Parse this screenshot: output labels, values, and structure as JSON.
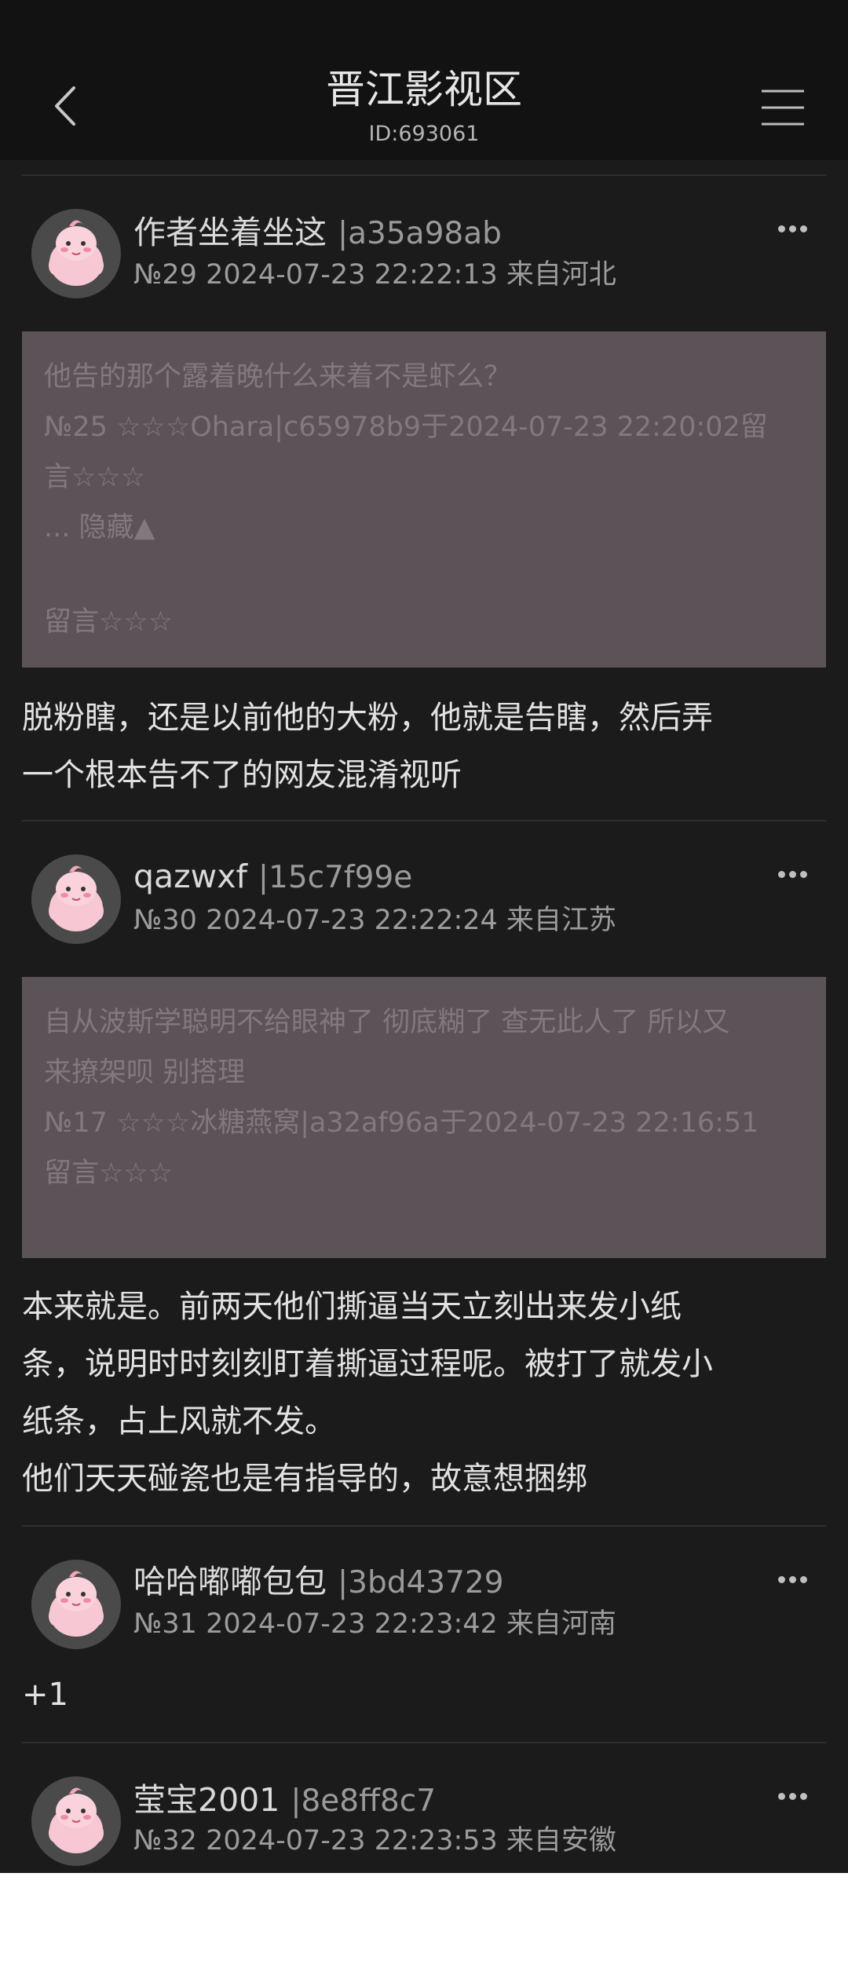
{
  "header": {
    "title": "晋江影视区",
    "id_label": "ID:693061"
  },
  "icons": {
    "back": "chevron-left-icon",
    "menu": "hamburger-menu-icon",
    "more": "more-dots-icon"
  },
  "colors": {
    "background": "#1b1b1b",
    "header": "#121212",
    "quote_bg": "#5c5358"
  },
  "posts": [
    {
      "name": "作者坐着坐这",
      "uid": "|a35a98ab",
      "meta": "№29 2024-07-23 22:22:13 来自河北",
      "quote": [
        "他告的那个露着晚什么来着不是虾么？",
        "№25 ☆☆☆Ohara|c65978b9于2024-07-23 22:20:02留",
        "言☆☆☆",
        "... 隐藏▲",
        "",
        "留言☆☆☆"
      ],
      "content": [
        "脱粉瞎，还是以前他的大粉，他就是告瞎，然后弄",
        "一个根本告不了的网友混淆视听"
      ]
    },
    {
      "name": "qazwxf",
      "uid": "|15c7f99e",
      "meta": "№30 2024-07-23 22:22:24 来自江苏",
      "quote": [
        "自从波斯学聪明不给眼神了 彻底糊了 查无此人了 所以又",
        "来撩架呗 别搭理",
        "№17 ☆☆☆冰糖燕窝|a32af96a于2024-07-23 22:16:51",
        "留言☆☆☆"
      ],
      "content": [
        "本来就是。前两天他们撕逼当天立刻出来发小纸",
        "条，说明时时刻刻盯着撕逼过程呢。被打了就发小",
        "纸条，占上风就不发。",
        "他们天天碰瓷也是有指导的，故意想捆绑"
      ]
    },
    {
      "name": "哈哈嘟嘟包包",
      "uid": "|3bd43729",
      "meta": "№31 2024-07-23 22:23:42 来自河南",
      "content": [
        "+1"
      ]
    },
    {
      "name": "莹宝2001",
      "uid": "|8e8ff8c7",
      "meta": "№32 2024-07-23 22:23:53 来自安徽"
    }
  ]
}
